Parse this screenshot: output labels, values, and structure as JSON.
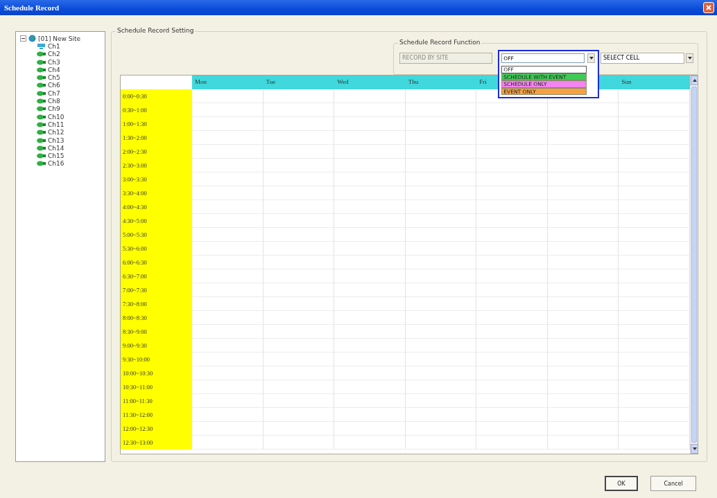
{
  "window": {
    "title": "Schedule Record"
  },
  "tree": {
    "label": "[01] New Site",
    "expanded": true,
    "children": [
      {
        "label": "Ch1",
        "kind": "monitor"
      },
      {
        "label": "Ch2",
        "kind": "camera"
      },
      {
        "label": "Ch3",
        "kind": "camera"
      },
      {
        "label": "Ch4",
        "kind": "camera"
      },
      {
        "label": "Ch5",
        "kind": "camera"
      },
      {
        "label": "Ch6",
        "kind": "camera"
      },
      {
        "label": "Ch7",
        "kind": "camera"
      },
      {
        "label": "Ch8",
        "kind": "camera"
      },
      {
        "label": "Ch9",
        "kind": "camera"
      },
      {
        "label": "Ch10",
        "kind": "camera"
      },
      {
        "label": "Ch11",
        "kind": "camera"
      },
      {
        "label": "Ch12",
        "kind": "camera"
      },
      {
        "label": "Ch13",
        "kind": "camera"
      },
      {
        "label": "Ch14",
        "kind": "camera"
      },
      {
        "label": "Ch15",
        "kind": "camera"
      },
      {
        "label": "Ch16",
        "kind": "camera"
      }
    ]
  },
  "setting_group": {
    "title": "Schedule Record Setting"
  },
  "function_group": {
    "title": "Schedule Record Function",
    "mode_field": {
      "value": "RECORD BY SITE",
      "disabled": true
    },
    "record_dropdown": {
      "value": "OFF",
      "options": [
        {
          "label": "OFF",
          "color": "#ffffff",
          "selected": true
        },
        {
          "label": "SCHEDULE WITH EVENT",
          "color": "#3ccc55",
          "selected": false
        },
        {
          "label": "SCHEDULE ONLY",
          "color": "#f384f0",
          "selected": false
        },
        {
          "label": "EVENT ONLY",
          "color": "#f8a040",
          "selected": false
        }
      ]
    },
    "cell_dropdown": {
      "value": "SELECT CELL"
    }
  },
  "table": {
    "columns": [
      {
        "label": "Mon"
      },
      {
        "label": "Tue"
      },
      {
        "label": "Wed"
      },
      {
        "label": "Thu"
      },
      {
        "label": "Fri"
      },
      {},
      {
        "label": "Sun"
      }
    ],
    "rows": [
      "0:00~0:30",
      "0:30~1:00",
      "1:00~1:30",
      "1:30~2:00",
      "2:00~2:30",
      "2:30~3:00",
      "3:00~3:30",
      "3:30~4:00",
      "4:00~4:30",
      "4:30~5:00",
      "5:00~5:30",
      "5:30~6:00",
      "6:00~6:30",
      "6:30~7:00",
      "7:00~7:30",
      "7:30~8:00",
      "8:00~8:30",
      "8:30~9:00",
      "9:00~9:30",
      "9:30~10:00",
      "10:00~10:30",
      "10:30~11:00",
      "11:00~11:30",
      "11:30~12:00",
      "12:00~12:30",
      "12:30~13:00"
    ]
  },
  "buttons": [
    {
      "label": "OK",
      "default": true
    },
    {
      "label": "Cancel",
      "default": false
    }
  ]
}
